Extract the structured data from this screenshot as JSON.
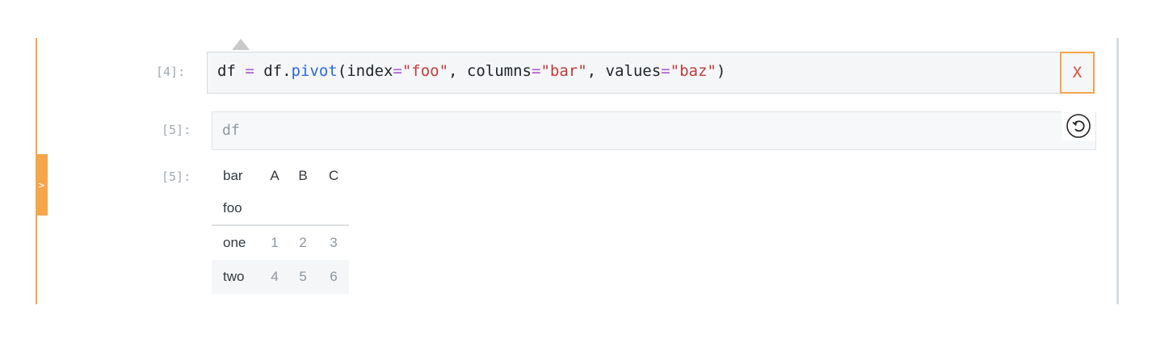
{
  "sidebar": {
    "collapse_label": ">"
  },
  "cells": [
    {
      "prompt": "[4]:",
      "code_tokens": [
        {
          "t": "df ",
          "c": "plain"
        },
        {
          "t": "=",
          "c": "op"
        },
        {
          "t": " df.",
          "c": "plain"
        },
        {
          "t": "pivot",
          "c": "fn"
        },
        {
          "t": "(index",
          "c": "plain"
        },
        {
          "t": "=",
          "c": "op"
        },
        {
          "t": "\"foo\"",
          "c": "str"
        },
        {
          "t": ", columns",
          "c": "plain"
        },
        {
          "t": "=",
          "c": "op"
        },
        {
          "t": "\"bar\"",
          "c": "str"
        },
        {
          "t": ", values",
          "c": "plain"
        },
        {
          "t": "=",
          "c": "op"
        },
        {
          "t": "\"baz\"",
          "c": "str"
        },
        {
          "t": ")",
          "c": "plain"
        }
      ],
      "delete_label": "X"
    },
    {
      "prompt": "[5]:",
      "code": "df",
      "undo_icon": "undo-icon"
    }
  ],
  "output": {
    "prompt": "[5]:",
    "columns_name": "bar",
    "columns": [
      "A",
      "B",
      "C"
    ],
    "index_name": "foo",
    "rows": [
      {
        "index": "one",
        "values": [
          "1",
          "2",
          "3"
        ]
      },
      {
        "index": "two",
        "values": [
          "4",
          "5",
          "6"
        ]
      }
    ]
  },
  "colors": {
    "accent": "#f5a54a",
    "delete": "#d94a38"
  }
}
